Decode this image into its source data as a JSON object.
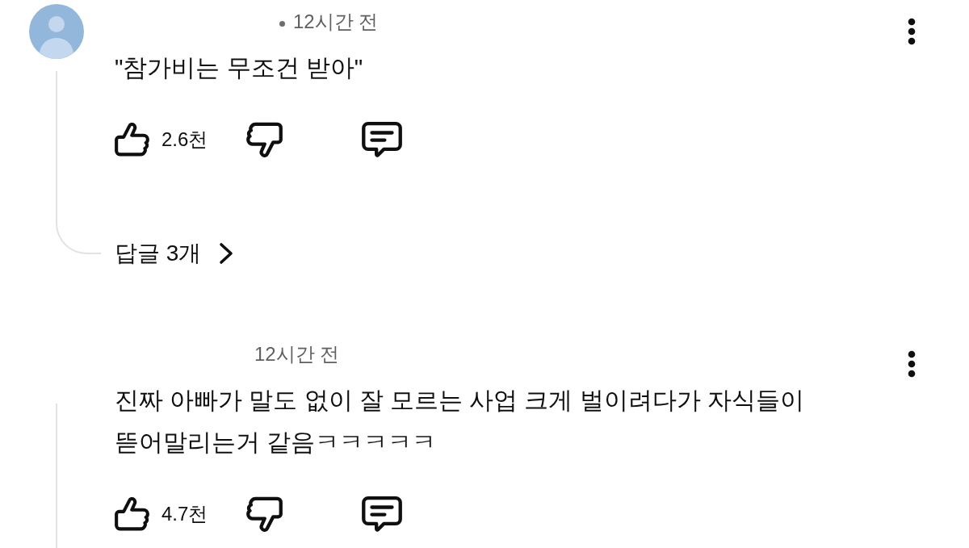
{
  "comments": [
    {
      "avatar": true,
      "dot": true,
      "time": "12시간 전",
      "text": "\"참가비는 무조건 받아\"",
      "likes": "2.6천",
      "replies": "답글 3개"
    },
    {
      "avatar": false,
      "dot": false,
      "time": "12시간 전",
      "text": "진짜 아빠가 말도 없이 잘 모르는 사업 크게 벌이려다가 자식들이 뜯어말리는거 같음ㅋㅋㅋㅋㅋ",
      "likes": "4.7천"
    }
  ]
}
